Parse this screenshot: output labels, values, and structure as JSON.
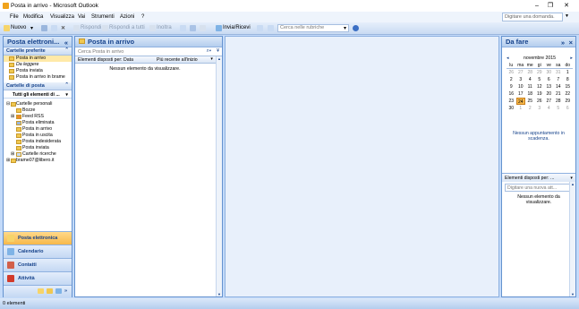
{
  "window": {
    "title": "Posta in arrivo - Microsoft Outlook",
    "min": "–",
    "max": "❐",
    "close": "✕"
  },
  "menu": {
    "items": [
      "File",
      "Modifica",
      "Visualizza",
      "Vai",
      "Strumenti",
      "Azioni",
      "?"
    ],
    "ask_placeholder": "Digitare una domanda."
  },
  "toolbar": {
    "new_label": "Nuovo",
    "reply_label": "Rispondi",
    "reply_all_label": "Rispondi a tutti",
    "forward_label": "Inoltra",
    "send_receive_label": "Invia/Ricevi",
    "search_ab_placeholder": "Cerca nelle rubriche"
  },
  "nav": {
    "title": "Posta elettroni...",
    "collapse": "«",
    "favorites_header": "Cartelle preferite",
    "favorites": [
      "Posta in arrivo",
      "Da leggere",
      "Posta inviata",
      "Posta in arrivo in brame"
    ],
    "folders_header": "Cartelle di posta",
    "all_items": "Tutti gli elementi di ...",
    "tree": [
      {
        "label": "Cartelle personali",
        "indent": 1
      },
      {
        "label": "Bozze",
        "indent": 2
      },
      {
        "label": "Feed RSS",
        "indent": 2
      },
      {
        "label": "Posta eliminata",
        "indent": 2
      },
      {
        "label": "Posta in arrivo",
        "indent": 2
      },
      {
        "label": "Posta in uscita",
        "indent": 2
      },
      {
        "label": "Posta indesiderata",
        "indent": 2
      },
      {
        "label": "Posta inviata",
        "indent": 2
      },
      {
        "label": "Cartelle ricerche",
        "indent": 2
      },
      {
        "label": "brame07@libero.it",
        "indent": 1
      }
    ],
    "buttons": [
      "Posta elettronica",
      "Calendario",
      "Contatti",
      "Attività"
    ]
  },
  "inbox": {
    "title": "Posta in arrivo",
    "search_placeholder": "Cerca Posta in arrivo",
    "sort_label": "Elementi disposti per: Data",
    "order_label": "Più recente all'inizio",
    "empty": "Nessun elemento da visualizzare."
  },
  "todo": {
    "title": "Da fare",
    "nav_left": "»",
    "close": "×",
    "month": "novembre 2015",
    "days": [
      "lu",
      "ma",
      "me",
      "gi",
      "ve",
      "sa",
      "do"
    ],
    "weeks": [
      [
        "26",
        "27",
        "28",
        "29",
        "30",
        "31",
        "1"
      ],
      [
        "2",
        "3",
        "4",
        "5",
        "6",
        "7",
        "8"
      ],
      [
        "9",
        "10",
        "11",
        "12",
        "13",
        "14",
        "15"
      ],
      [
        "16",
        "17",
        "18",
        "19",
        "20",
        "21",
        "22"
      ],
      [
        "23",
        "24",
        "25",
        "26",
        "27",
        "28",
        "29"
      ],
      [
        "30",
        "1",
        "2",
        "3",
        "4",
        "5",
        "6"
      ]
    ],
    "today": "24",
    "no_appointments": "Nessun appuntamento in scadenza.",
    "tasks_header": "Elementi disposti per: ...",
    "task_placeholder": "Digitare una nuova att...",
    "no_tasks": "Nessun elemento da visualizzare."
  },
  "status": {
    "text": "0 elementi"
  },
  "colors": {
    "accent": "#15428b",
    "pane_bg": "#c3daf9",
    "selected": "#f7b84a"
  }
}
